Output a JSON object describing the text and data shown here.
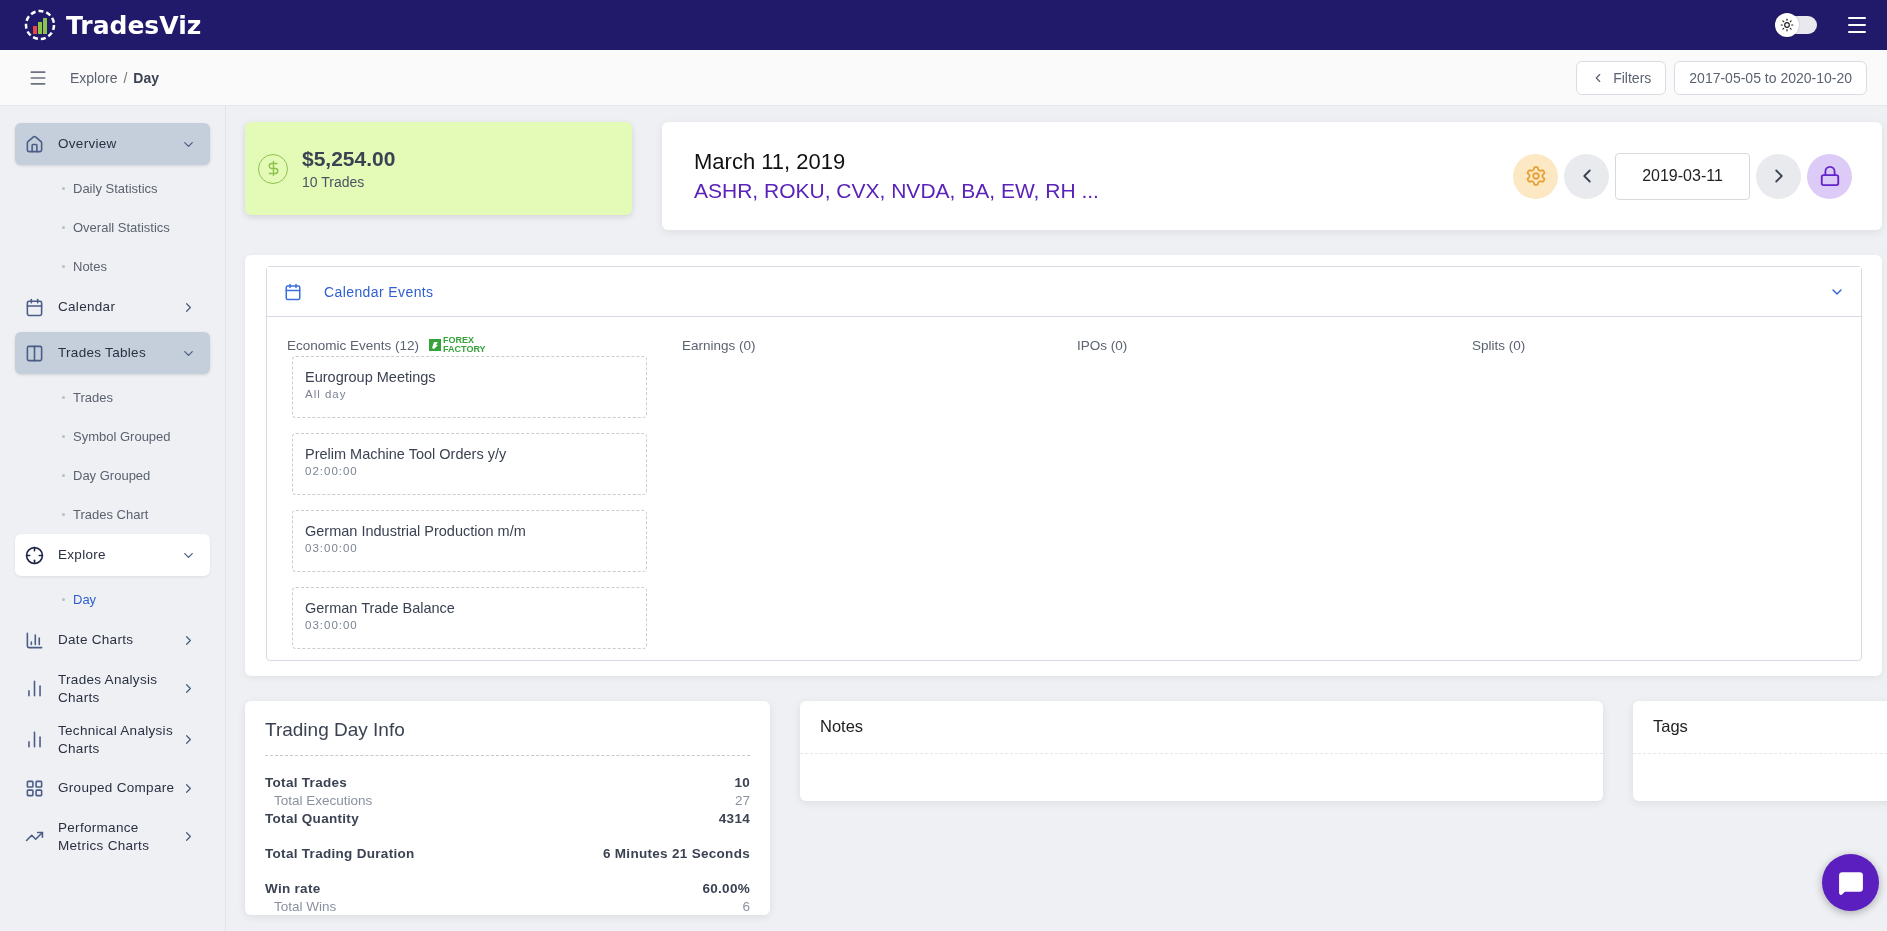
{
  "app": {
    "brand": "TradesViz",
    "dark_mode": false
  },
  "breadcrumb": {
    "parent": "Explore",
    "separator": "/",
    "current": "Day"
  },
  "header_actions": {
    "filters": "Filters",
    "date_range": "2017-05-05 to 2020-10-20"
  },
  "sidebar": {
    "items": [
      {
        "label": "Overview",
        "expanded": true,
        "selected": false,
        "children": [
          {
            "label": "Daily Statistics",
            "selected": false
          },
          {
            "label": "Overall Statistics",
            "selected": false
          },
          {
            "label": "Notes",
            "selected": false
          }
        ]
      },
      {
        "label": "Calendar",
        "expanded": false,
        "selected": false
      },
      {
        "label": "Trades Tables",
        "expanded": true,
        "selected": false,
        "children": [
          {
            "label": "Trades",
            "selected": false
          },
          {
            "label": "Symbol Grouped",
            "selected": false
          },
          {
            "label": "Day Grouped",
            "selected": false
          },
          {
            "label": "Trades Chart",
            "selected": false
          }
        ]
      },
      {
        "label": "Explore",
        "expanded": true,
        "selected": true,
        "children": [
          {
            "label": "Day",
            "selected": true
          }
        ]
      },
      {
        "label": "Date Charts",
        "expanded": false,
        "selected": false
      },
      {
        "label": "Trades Analysis Charts",
        "expanded": false,
        "selected": false
      },
      {
        "label": "Technical Analysis Charts",
        "expanded": false,
        "selected": false
      },
      {
        "label": "Grouped Compare",
        "expanded": false,
        "selected": false
      },
      {
        "label": "Performance Metrics Charts",
        "expanded": false,
        "selected": false
      }
    ]
  },
  "summary": {
    "amount": "$5,254.00",
    "trades": "10 Trades"
  },
  "day": {
    "date": "March 11, 2019",
    "symbols": "ASHR, ROKU, CVX, NVDA, BA, EW, RH ...",
    "date_value": "2019-03-11"
  },
  "calendar_events": {
    "title": "Calendar Events",
    "expanded": true,
    "economic": {
      "heading": "Economic Events (12)",
      "source_logo": "FOREX FACTORY",
      "events": [
        {
          "name": "Eurogroup Meetings",
          "time": "All day"
        },
        {
          "name": "Prelim Machine Tool Orders y/y",
          "time": "02:00:00"
        },
        {
          "name": "German Industrial Production m/m",
          "time": "03:00:00"
        },
        {
          "name": "German Trade Balance",
          "time": "03:00:00"
        }
      ]
    },
    "columns": [
      "Earnings (0)",
      "IPOs (0)",
      "Splits (0)"
    ]
  },
  "trading_day_info": {
    "title": "Trading Day Info",
    "groups": [
      [
        {
          "label": "Total Trades",
          "value": "10",
          "kind": "main"
        },
        {
          "label": "Total Executions",
          "value": "27",
          "kind": "sub"
        },
        {
          "label": "Total Quantity",
          "value": "4314",
          "kind": "main"
        }
      ],
      [
        {
          "label": "Total Trading Duration",
          "value": "6 Minutes 21 Seconds",
          "kind": "main"
        }
      ],
      [
        {
          "label": "Win rate",
          "value": "60.00%",
          "kind": "main"
        },
        {
          "label": "Total Wins",
          "value": "6",
          "kind": "sub"
        }
      ]
    ]
  },
  "notes": {
    "title": "Notes"
  },
  "tags": {
    "title": "Tags"
  }
}
